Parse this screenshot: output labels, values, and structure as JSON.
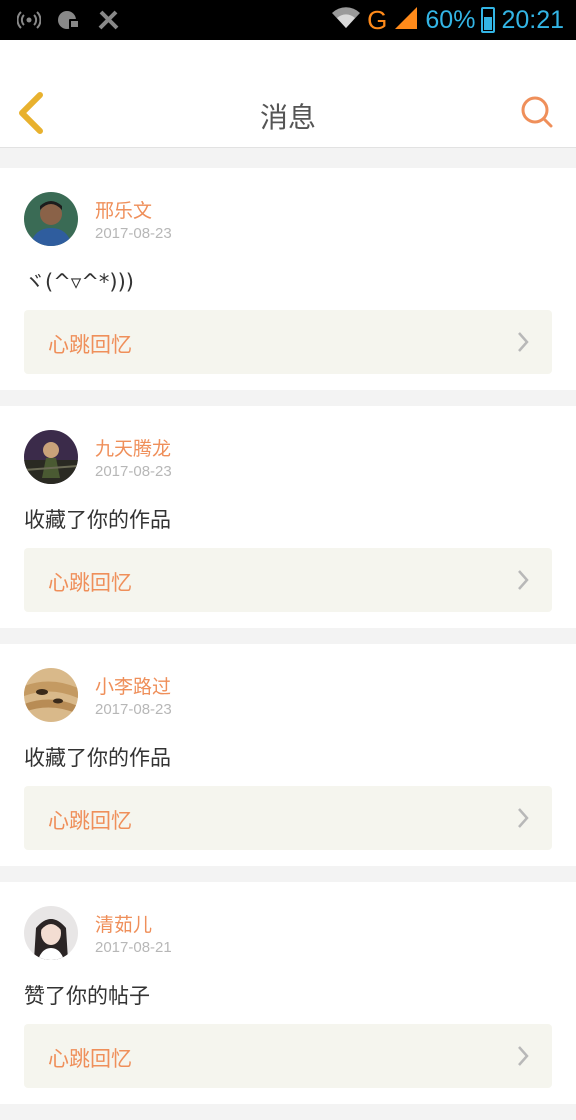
{
  "status_bar": {
    "network": "G",
    "battery": "60%",
    "time": "20:21"
  },
  "header": {
    "title": "消息"
  },
  "messages": [
    {
      "name": "邢乐文",
      "date": "2017-08-23",
      "text": "ヾ(^▿^*)))",
      "link": "心跳回忆"
    },
    {
      "name": "九天腾龙",
      "date": "2017-08-23",
      "text": "收藏了你的作品",
      "link": "心跳回忆"
    },
    {
      "name": "小李路过",
      "date": "2017-08-23",
      "text": "收藏了你的作品",
      "link": "心跳回忆"
    },
    {
      "name": "清茹儿",
      "date": "2017-08-21",
      "text": "赞了你的帖子",
      "link": "心跳回忆"
    }
  ],
  "colors": {
    "accent": "#ef8f5a",
    "back_icon": "#e8b12e",
    "link_bg": "#f5f5ee",
    "status_blue": "#33b5e5"
  }
}
